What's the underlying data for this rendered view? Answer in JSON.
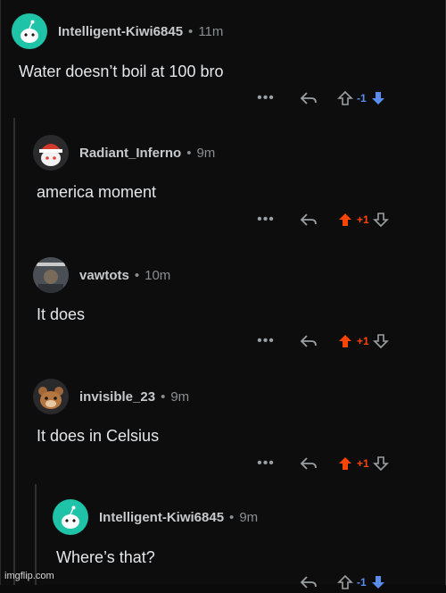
{
  "comments": [
    {
      "username": "Intelligent-Kiwi6845",
      "time": "11m",
      "text": "Water doesn’t boil at 100 bro",
      "score": "-1",
      "vote_state": "down",
      "avatar": "snoo-teal",
      "colors": {
        "down": "#5a8dee",
        "up": "#ff4500",
        "neutral": "#9aa0a3"
      }
    },
    {
      "username": "Radiant_Inferno",
      "time": "9m",
      "text": "america moment",
      "score": "+1",
      "vote_state": "up",
      "avatar": "snoo-red-hat"
    },
    {
      "username": "vawtots",
      "time": "10m",
      "text": "It does",
      "score": "+1",
      "vote_state": "up",
      "avatar": "photo-thumbnail"
    },
    {
      "username": "invisible_23",
      "time": "9m",
      "text": "It does in Celsius",
      "score": "+1",
      "vote_state": "up",
      "avatar": "snoo-brown-bear"
    },
    {
      "username": "Intelligent-Kiwi6845",
      "time": "9m",
      "text": "Where’s that?",
      "score": "-1",
      "vote_state": "down",
      "avatar": "snoo-teal"
    }
  ],
  "separator": "•",
  "more_label": "•••",
  "watermark": "imgflip.com"
}
